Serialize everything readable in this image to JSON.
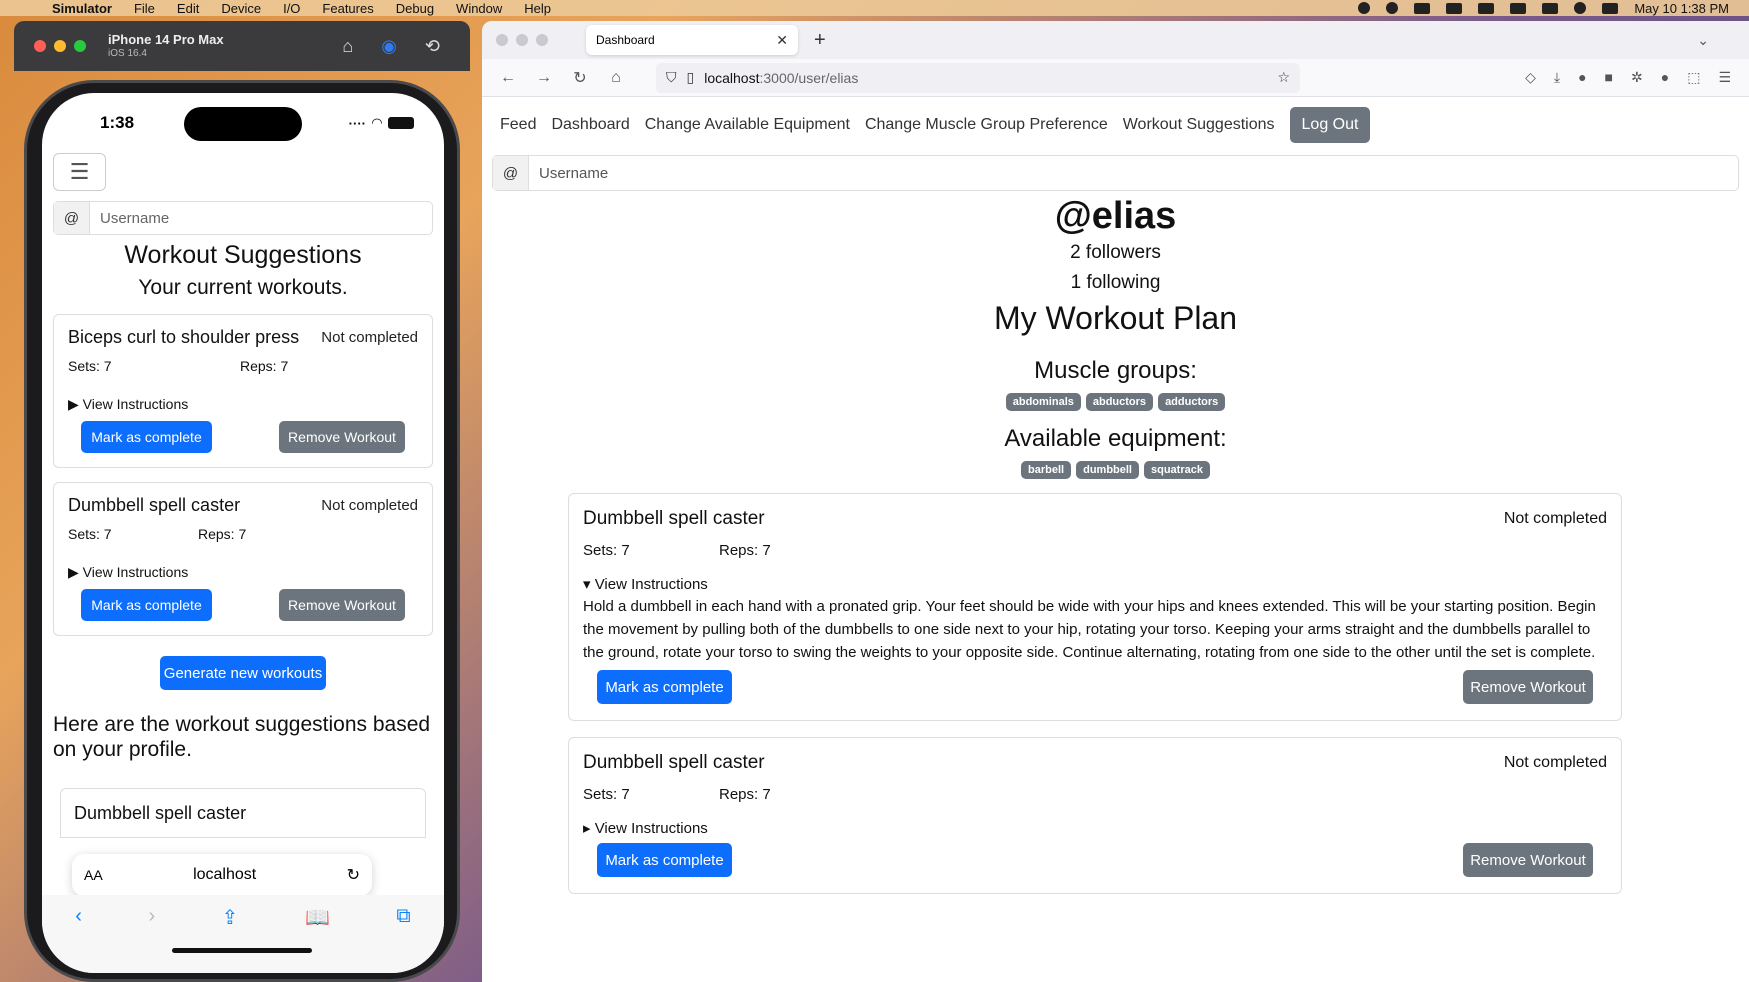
{
  "menubar": {
    "app": "Simulator",
    "items": [
      "File",
      "Edit",
      "Device",
      "I/O",
      "Features",
      "Debug",
      "Window",
      "Help"
    ],
    "clock": "May 10  1:38 PM"
  },
  "simulator": {
    "device": "iPhone 14 Pro Max",
    "os": "iOS 16.4"
  },
  "phone": {
    "time": "1:38",
    "username_prefix": "@",
    "username_placeholder": "Username",
    "title": "Workout Suggestions",
    "subtitle": "Your current workouts.",
    "workouts": [
      {
        "name": "Biceps curl to shoulder press",
        "status": "Not completed",
        "sets": "Sets: 7",
        "reps": "Reps: 7",
        "instructions_label": "View Instructions",
        "complete_label": "Mark as complete",
        "remove_label": "Remove Workout"
      },
      {
        "name": "Dumbbell spell caster",
        "status": "Not completed",
        "sets": "Sets: 7",
        "reps": "Reps: 7",
        "instructions_label": "View Instructions",
        "complete_label": "Mark as complete",
        "remove_label": "Remove Workout"
      }
    ],
    "generate_label": "Generate new workouts",
    "suggestions_heading": "Here are the workout suggestions based on your profile.",
    "suggestion_card_title": "Dumbbell spell caster",
    "safari": {
      "aa": "AA",
      "host": "localhost"
    }
  },
  "browser": {
    "tab_title": "Dashboard",
    "url_host": "localhost",
    "url_path": ":3000/user/elias",
    "nav": [
      "Feed",
      "Dashboard",
      "Change Available Equipment",
      "Change Muscle Group Preference",
      "Workout Suggestions"
    ],
    "logout_label": "Log Out",
    "username_prefix": "@",
    "username_placeholder": "Username",
    "handle": "@elias",
    "followers": "2 followers",
    "following": "1 following",
    "plan_title": "My Workout Plan",
    "muscle_groups_title": "Muscle groups:",
    "muscle_groups": [
      "abdominals",
      "abductors",
      "adductors"
    ],
    "equipment_title": "Available equipment:",
    "equipment": [
      "barbell",
      "dumbbell",
      "squatrack"
    ],
    "workouts": [
      {
        "name": "Dumbbell spell caster",
        "status": "Not completed",
        "sets": "Sets: 7",
        "reps": "Reps: 7",
        "instructions_label": "View Instructions",
        "instructions_text": "Hold a dumbbell in each hand with a pronated grip. Your feet should be wide with your hips and knees extended. This will be your starting position. Begin the movement by pulling both of the dumbbells to one side next to your hip, rotating your torso. Keeping your arms straight and the dumbbells parallel to the ground, rotate your torso to swing the weights to your opposite side. Continue alternating, rotating from one side to the other until the set is complete.",
        "complete_label": "Mark as complete",
        "remove_label": "Remove Workout"
      },
      {
        "name": "Dumbbell spell caster",
        "status": "Not completed",
        "sets": "Sets: 7",
        "reps": "Reps: 7",
        "instructions_label": "View Instructions",
        "complete_label": "Mark as complete",
        "remove_label": "Remove Workout"
      }
    ]
  },
  "colors": {
    "primary": "#0d6efd",
    "secondary": "#6c757d"
  }
}
